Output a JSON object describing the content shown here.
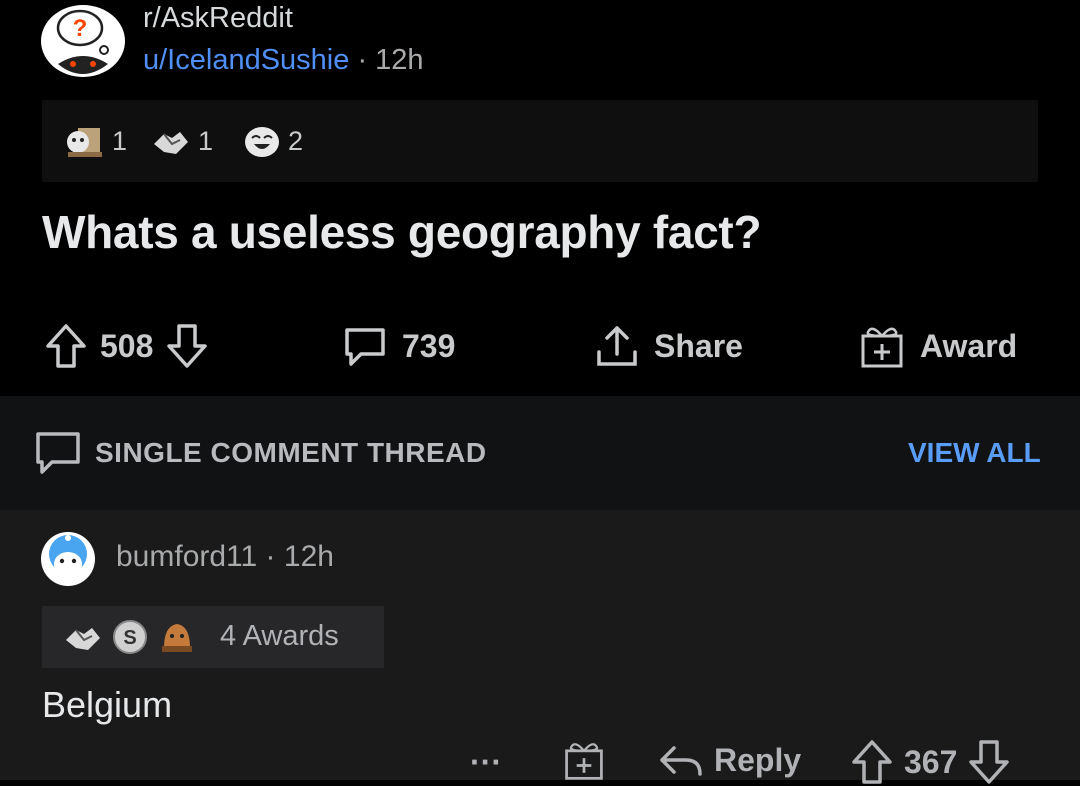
{
  "post": {
    "subreddit": "r/AskReddit",
    "author": "u/IcelandSushie",
    "separator": "·",
    "time": "12h",
    "awards": [
      {
        "icon": "wholesome-seal-award-icon",
        "count": "1"
      },
      {
        "icon": "helpful-handshake-award-icon",
        "count": "1"
      },
      {
        "icon": "laughing-award-icon",
        "count": "2"
      }
    ],
    "title": "Whats a useless geography fact?",
    "actions": {
      "votes": "508",
      "comments": "739",
      "share": "Share",
      "award": "Award"
    }
  },
  "thread": {
    "label": "SINGLE COMMENT THREAD",
    "view_all": "VIEW ALL"
  },
  "comment": {
    "author": "bumford11",
    "separator": "·",
    "time": "12h",
    "awards_label": "4 Awards",
    "award_icons": [
      "helpful-handshake-award-icon",
      "silver-award-icon",
      "gold-award-icon"
    ],
    "body": "Belgium",
    "actions": {
      "more": "···",
      "reply": "Reply",
      "votes": "367"
    }
  },
  "colors": {
    "background": "#000000",
    "comment_background": "#1a1a1b",
    "link_blue": "#4f8ff7",
    "text": "#d7dadc"
  }
}
